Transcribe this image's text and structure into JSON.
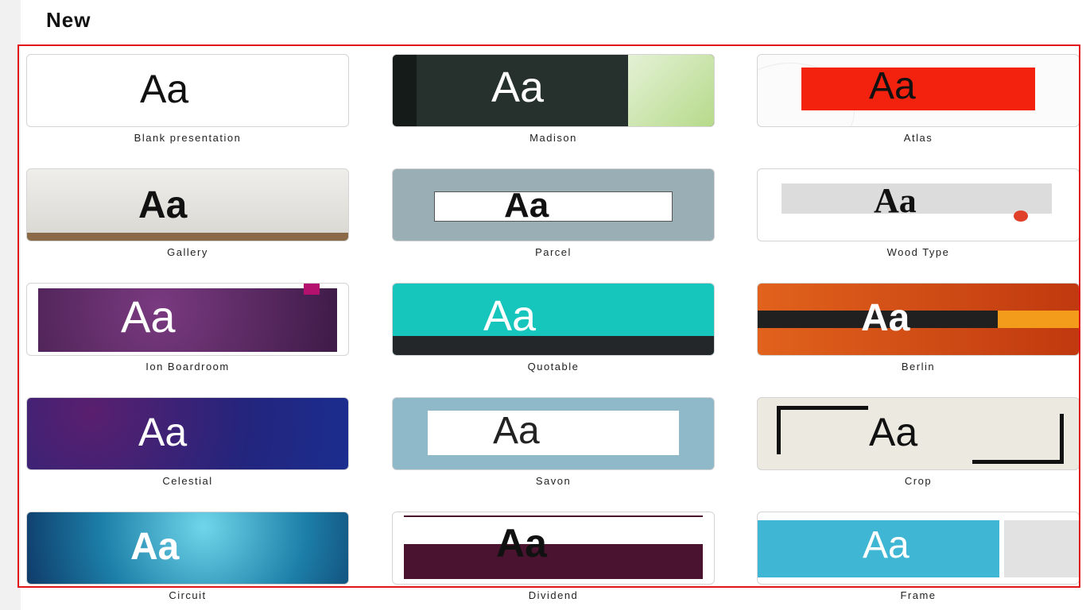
{
  "header": {
    "title": "New"
  },
  "templates": [
    {
      "name": "Blank presentation",
      "sample": "Aa",
      "icon": "blank-theme-thumbnail",
      "colors": {
        "bg": "#ffffff",
        "text": "#111111"
      }
    },
    {
      "name": "Madison",
      "sample": "Aa",
      "icon": "madison-theme-thumbnail",
      "colors": {
        "bg": "#26302d",
        "accent": "#cfe6b2",
        "text": "#ffffff"
      }
    },
    {
      "name": "Atlas",
      "sample": "Aa",
      "icon": "atlas-theme-thumbnail",
      "colors": {
        "bg": "#ffffff",
        "accent": "#f2220f",
        "text": "#111111"
      }
    },
    {
      "name": "Gallery",
      "sample": "Aa",
      "icon": "gallery-theme-thumbnail",
      "colors": {
        "bg": "#e6e5e1",
        "accent": "#8a6a48",
        "text": "#111111"
      }
    },
    {
      "name": "Parcel",
      "sample": "Aa",
      "icon": "parcel-theme-thumbnail",
      "colors": {
        "bg": "#9aaeb6",
        "accent": "#ffffff",
        "text": "#111111"
      }
    },
    {
      "name": "Wood Type",
      "sample": "Aa",
      "icon": "wood-type-theme-thumbnail",
      "colors": {
        "bg": "#ffffff",
        "accent": "#d9d9d9",
        "text": "#111111"
      }
    },
    {
      "name": "Ion Boardroom",
      "sample": "Aa",
      "icon": "ion-boardroom-theme-thumbnail",
      "colors": {
        "bg": "#4c2455",
        "accent": "#b4106e",
        "text": "#ffffff"
      }
    },
    {
      "name": "Quotable",
      "sample": "Aa",
      "icon": "quotable-theme-thumbnail",
      "colors": {
        "bg": "#16c6bc",
        "accent": "#23272a",
        "text": "#ffffff"
      }
    },
    {
      "name": "Berlin",
      "sample": "Aa",
      "icon": "berlin-theme-thumbnail",
      "colors": {
        "bg": "#d4501a",
        "accent": "#f39b1a",
        "text": "#ffffff"
      }
    },
    {
      "name": "Celestial",
      "sample": "Aa",
      "icon": "celestial-theme-thumbnail",
      "colors": {
        "bg": "#2a2b82",
        "accent": "#5a1f6e",
        "text": "#ffffff"
      }
    },
    {
      "name": "Savon",
      "sample": "Aa",
      "icon": "savon-theme-thumbnail",
      "colors": {
        "bg": "#8fb8c9",
        "accent": "#ffffff",
        "text": "#222222"
      }
    },
    {
      "name": "Crop",
      "sample": "Aa",
      "icon": "crop-theme-thumbnail",
      "colors": {
        "bg": "#ece9e1",
        "accent": "#111111",
        "text": "#111111"
      }
    },
    {
      "name": "Circuit",
      "sample": "Aa",
      "icon": "circuit-theme-thumbnail",
      "colors": {
        "bg": "#1c7fa8",
        "accent": "#3bc2de",
        "text": "#ffffff"
      }
    },
    {
      "name": "Dividend",
      "sample": "Aa",
      "icon": "dividend-theme-thumbnail",
      "colors": {
        "bg": "#ffffff",
        "accent": "#4a1430",
        "text": "#111111"
      }
    },
    {
      "name": "Frame",
      "sample": "Aa",
      "icon": "frame-theme-thumbnail",
      "colors": {
        "bg": "#ffffff",
        "accent": "#3fb6d3",
        "text": "#ffffff"
      }
    }
  ]
}
